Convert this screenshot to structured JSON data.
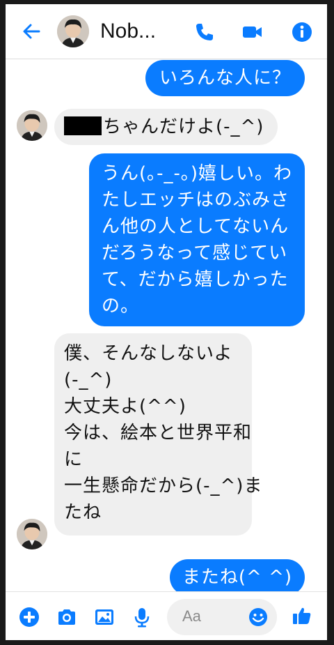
{
  "header": {
    "contact_name": "Nob...",
    "icons": [
      "back-arrow-icon",
      "phone-icon",
      "video-camera-icon",
      "info-icon"
    ]
  },
  "messages": [
    {
      "sender": "me",
      "lines": [
        "いろんな人に？"
      ]
    },
    {
      "sender": "them",
      "redacted": true,
      "lines": [
        "ちゃんだけよ(-_^)"
      ]
    },
    {
      "sender": "me",
      "lines": [
        "うん(｡-_-｡)嬉しい。わ",
        "たしエッチはのぶみさ",
        "ん他の人としてないん",
        "だろうなって感じてい",
        "て、だから嬉しかった",
        "の。"
      ]
    },
    {
      "sender": "them",
      "lines": [
        "僕、そんなしないよ",
        "(-_^)",
        "大丈夫よ(^^)",
        "今は、絵本と世界平和",
        "に",
        "一生懸命だから(-_^)ま",
        "たね"
      ]
    },
    {
      "sender": "me",
      "lines": [
        "またね(^ ^)"
      ]
    }
  ],
  "composer": {
    "placeholder": "Aa"
  },
  "toolbar": {
    "icons": [
      "plus-icon",
      "camera-icon",
      "image-icon",
      "microphone-icon",
      "emoji-icon",
      "thumbs-up-icon"
    ]
  },
  "colors": {
    "accent": "#0a7cff",
    "incoming_bubble": "#efefef",
    "outgoing_text": "#ffffff"
  }
}
